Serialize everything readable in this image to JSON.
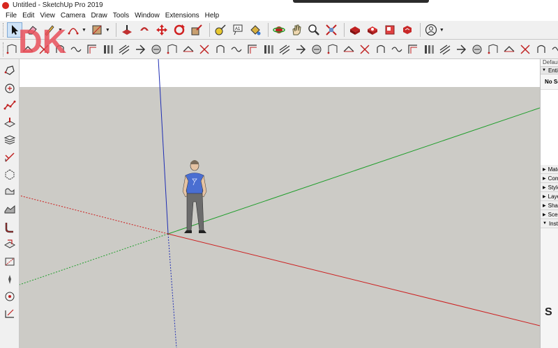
{
  "window": {
    "title": "Untitled - SketchUp Pro 2019"
  },
  "menu": [
    "File",
    "Edit",
    "View",
    "Camera",
    "Draw",
    "Tools",
    "Window",
    "Extensions",
    "Help"
  ],
  "logo": {
    "text": "DK",
    "color": "#e8505b"
  },
  "toolbar_top": [
    "select-icon",
    "eraser-icon",
    "line-pencil-icon",
    "arc-icon",
    "rectangle-icon",
    "push-pull-icon",
    "offset-icon",
    "move-icon",
    "rotate-icon",
    "scale-icon",
    "tape-measure-icon",
    "text-icon",
    "paint-bucket-icon",
    "orbit-icon",
    "pan-icon",
    "zoom-icon",
    "zoom-extents-icon",
    "warehouse-icon",
    "extension-warehouse-icon",
    "layout-icon",
    "extension-manager-icon",
    "account-icon"
  ],
  "toolbar_second_count": 44,
  "left_toolbar": [
    "offset-tool-icon",
    "circle-tool-icon",
    "polyline-icon",
    "push-pull-tool-icon",
    "layers-icon",
    "axes-tool-icon",
    "rotated-shape-icon",
    "freehand-icon",
    "sandbox-icon",
    "follow-me-icon",
    "section-plane-icon",
    "x-ray-icon",
    "walk-icon",
    "look-around-icon",
    "dimension-icon"
  ],
  "tray": {
    "title": "Default Tray",
    "entity_info_label": "Entity Info",
    "selection_text": "No Selection",
    "sections": [
      {
        "label": "Materials",
        "expanded": false
      },
      {
        "label": "Components",
        "expanded": false
      },
      {
        "label": "Styles",
        "expanded": false
      },
      {
        "label": "Layers",
        "expanded": false
      },
      {
        "label": "Shadows",
        "expanded": false
      },
      {
        "label": "Scenes",
        "expanded": false
      },
      {
        "label": "Instructor",
        "expanded": true
      }
    ],
    "bottom_glyph": "S"
  },
  "colors": {
    "sky": "#ffffff",
    "ground": "#cccbc6",
    "axis_red": "#cc1f1f",
    "axis_green": "#1f9e2b",
    "axis_blue": "#1e2db3",
    "shirt": "#4a6ed1"
  }
}
